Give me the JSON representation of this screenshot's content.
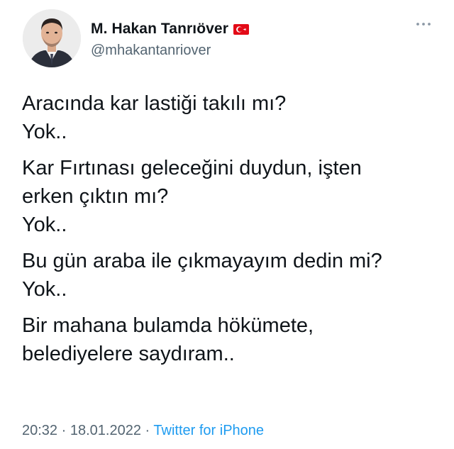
{
  "author": {
    "display_name": "M. Hakan Tanrıöver",
    "handle": "@mhakantanriover",
    "flag": "turkey-flag-icon"
  },
  "tweet": {
    "paragraphs": [
      [
        "Aracında kar lastiği takılı mı?",
        "Yok.."
      ],
      [
        "Kar Fırtınası geleceğini duydun, işten",
        "erken çıktın mı?",
        "Yok.."
      ],
      [
        "Bu gün araba ile çıkmayayım dedin mi?",
        "Yok.."
      ],
      [
        "Bir mahana bulamda hökümete,",
        "belediyelere saydıram.."
      ]
    ]
  },
  "meta": {
    "time": "20:32",
    "separator": "·",
    "date": "18.01.2022",
    "source": "Twitter for iPhone"
  },
  "colors": {
    "text": "#0f1419",
    "secondary": "#536471",
    "link": "#1d9bf0",
    "flag_red": "#e30a17"
  }
}
